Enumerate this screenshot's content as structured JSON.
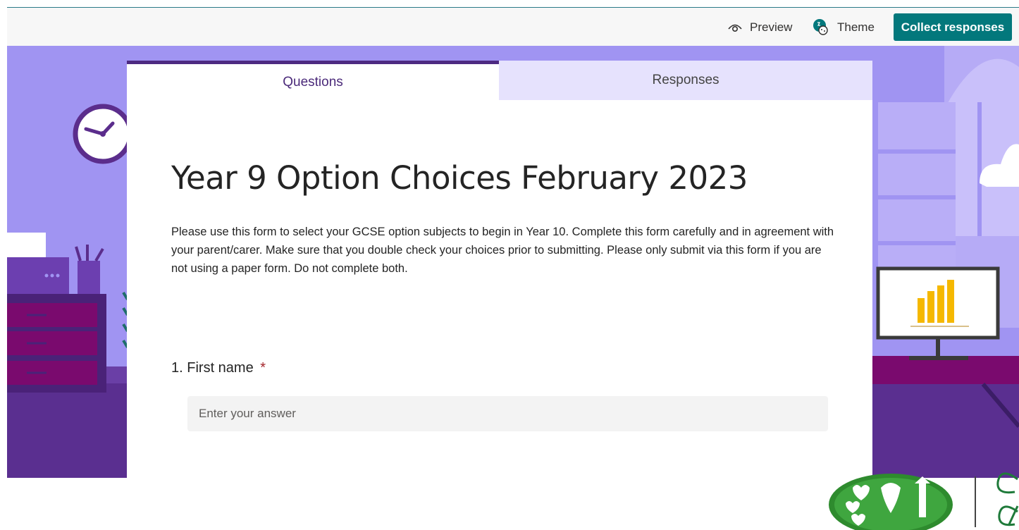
{
  "toolbar": {
    "preview_label": "Preview",
    "theme_label": "Theme",
    "collect_label": "Collect responses",
    "preview_icon": "eye-icon",
    "theme_icon": "palette-icon",
    "accent_color": "#03787c"
  },
  "tabs": [
    {
      "label": "Questions",
      "selected": true
    },
    {
      "label": "Responses",
      "selected": false
    }
  ],
  "form": {
    "title": "Year 9 Option Choices February 2023",
    "description": "Please use this form to select your GCSE option subjects to begin in Year 10. Complete this form carefully and in agreement with your parent/carer. Make sure that you double check your choices prior to submitting. Please only submit via this form if you are not using a paper form. Do not complete both.",
    "questions": [
      {
        "number": "1.",
        "label": "First name",
        "required_mark": "*",
        "placeholder": "Enter your answer",
        "value": ""
      }
    ]
  },
  "theme": {
    "background_color": "#a094f2",
    "tab_accent": "#4d2a82"
  }
}
